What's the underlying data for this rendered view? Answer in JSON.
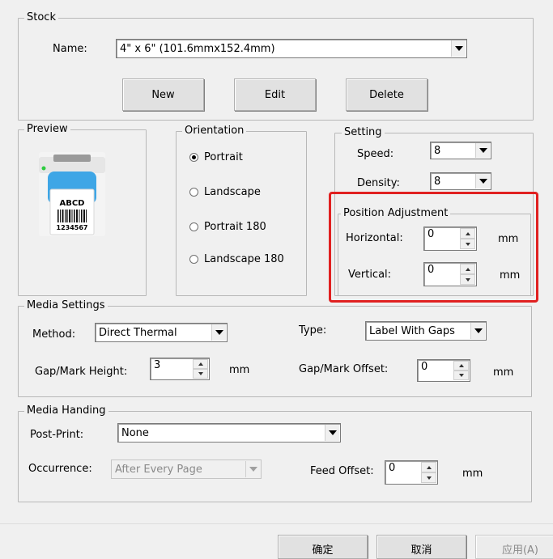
{
  "stock": {
    "legend": "Stock",
    "name_label": "Name:",
    "name_value": "4\" x 6\" (101.6mmx152.4mm)",
    "new_label": "New",
    "edit_label": "Edit",
    "delete_label": "Delete"
  },
  "preview": {
    "legend": "Preview",
    "label_text": "ABCD",
    "barcode_number": "1234567"
  },
  "orientation": {
    "legend": "Orientation",
    "options": [
      "Portrait",
      "Landscape",
      "Portrait 180",
      "Landscape 180"
    ],
    "selected": "Portrait"
  },
  "setting": {
    "legend": "Setting",
    "speed_label": "Speed:",
    "speed_value": "8",
    "density_label": "Density:",
    "density_value": "8"
  },
  "position": {
    "legend": "Position Adjustment",
    "horizontal_label": "Horizontal:",
    "horizontal_value": "0",
    "vertical_label": "Vertical:",
    "vertical_value": "0",
    "unit": "mm",
    "highlight_color": "#e02020"
  },
  "media_settings": {
    "legend": "Media Settings",
    "method_label": "Method:",
    "method_value": "Direct Thermal",
    "type_label": "Type:",
    "type_value": "Label With Gaps",
    "gap_label": "Gap/Mark Height:",
    "gap_value": "3",
    "gap_unit": "mm",
    "offset_label": "Gap/Mark Offset:",
    "offset_value": "0",
    "offset_unit": "mm"
  },
  "media_handing": {
    "legend": "Media Handing",
    "postprint_label": "Post-Print:",
    "postprint_value": "None",
    "occurrence_label": "Occurrence:",
    "occurrence_value": "After Every Page",
    "feed_label": "Feed Offset:",
    "feed_value": "0",
    "feed_unit": "mm"
  },
  "footer": {
    "ok_label": "确定",
    "cancel_label": "取消",
    "apply_label": "应用(A)"
  }
}
